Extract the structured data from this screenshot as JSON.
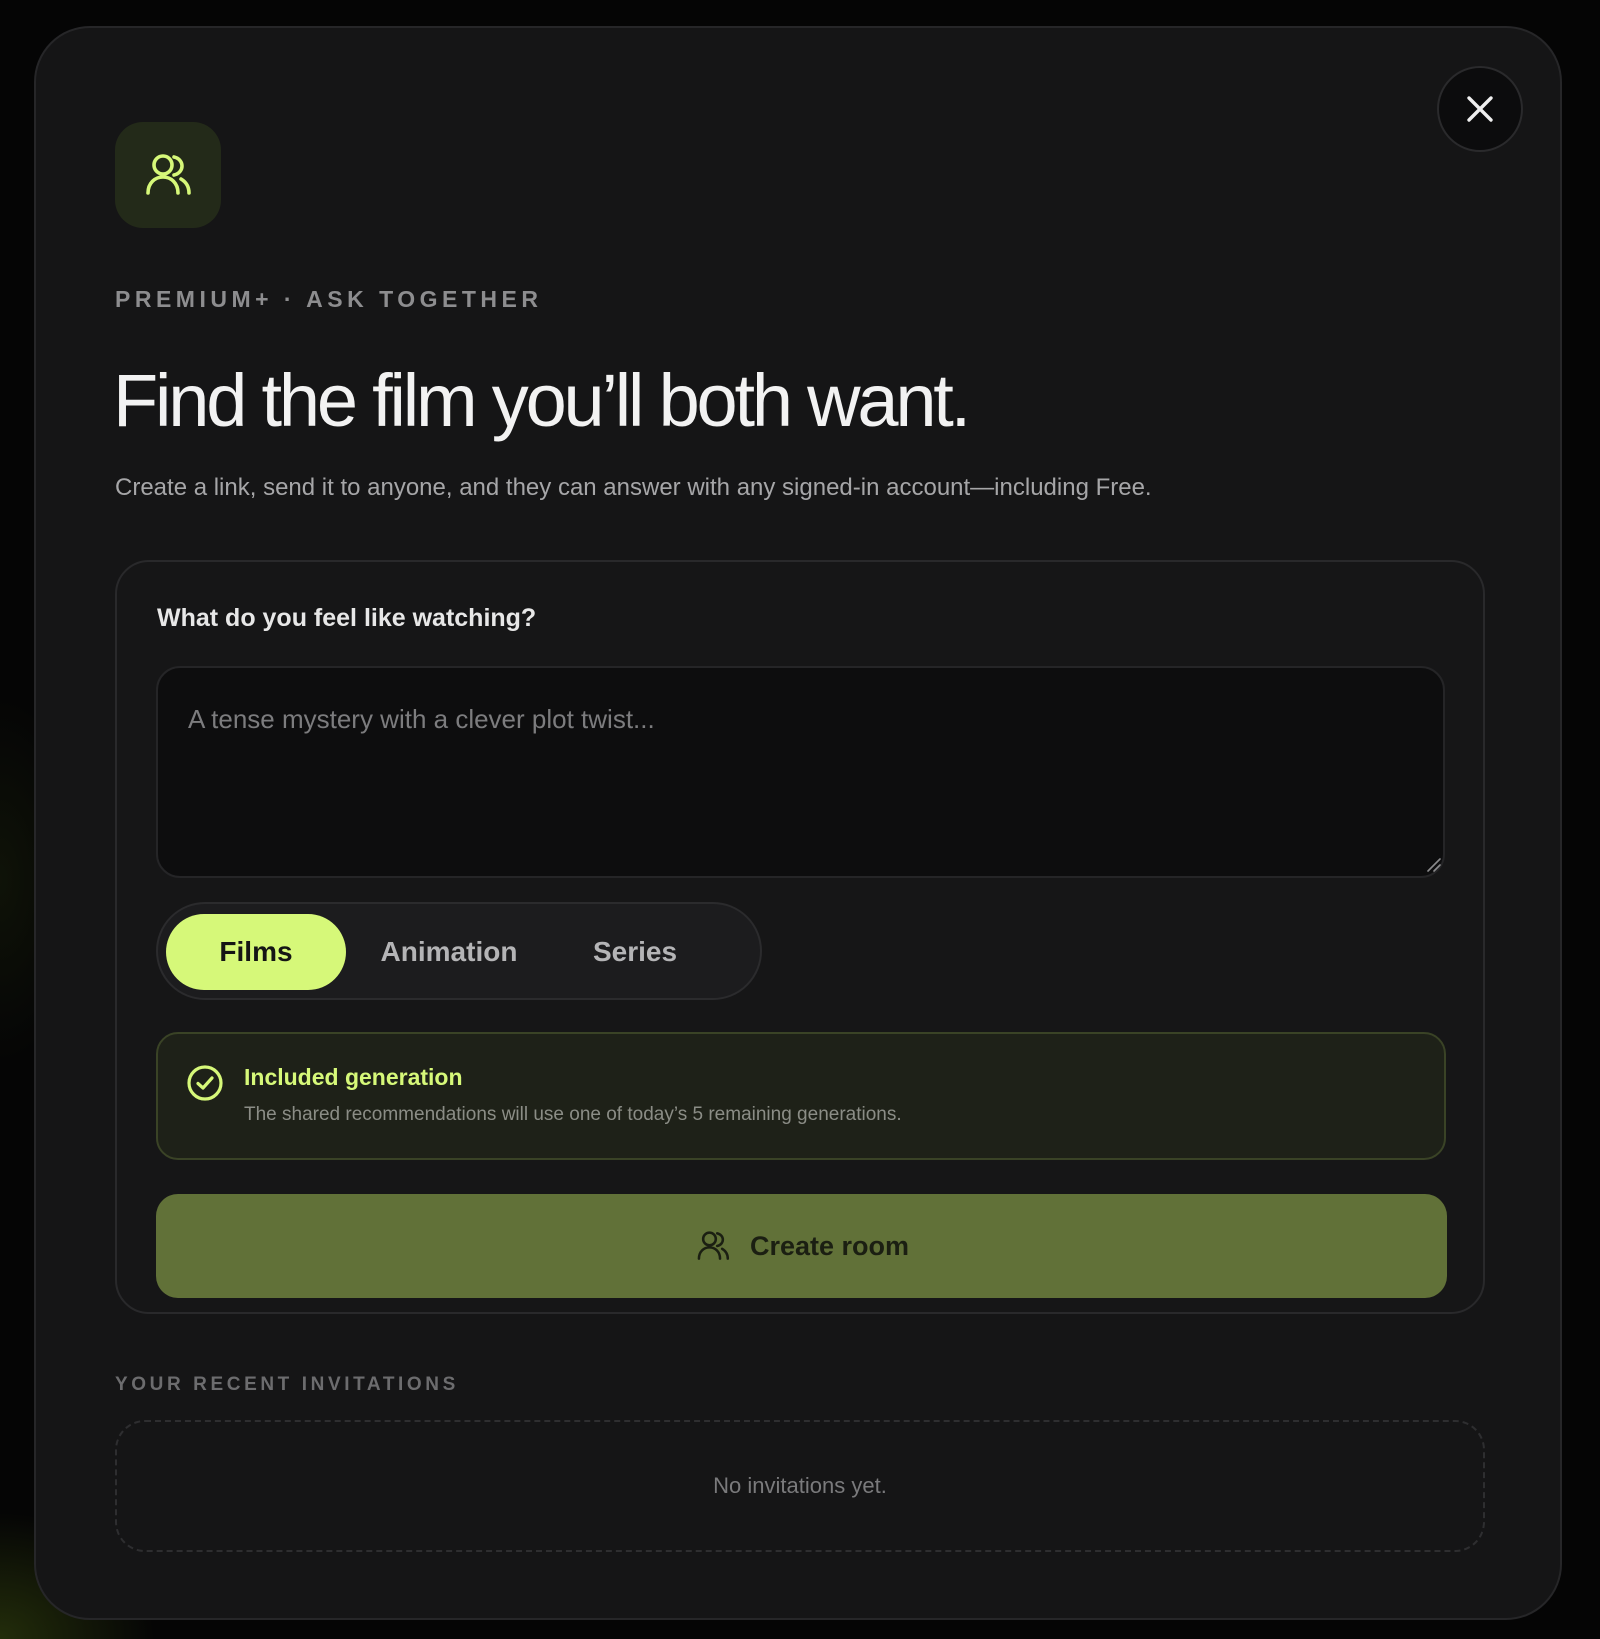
{
  "modal": {
    "eyebrow": "PREMIUM+ · ASK TOGETHER",
    "title": "Find the film you’ll both want.",
    "subtitle": "Create a link, send it to anyone, and they can answer with any signed-in account—including Free.",
    "close_icon": "close-icon",
    "badge_icon": "users-icon"
  },
  "form": {
    "question_label": "What do you feel like watching?",
    "prompt_value": "",
    "prompt_placeholder": "A tense mystery with a clever plot twist...",
    "content_types": [
      {
        "label": "Films",
        "selected": true
      },
      {
        "label": "Animation",
        "selected": false
      },
      {
        "label": "Series",
        "selected": false
      }
    ],
    "notice": {
      "icon": "check-circle-icon",
      "title": "Included generation",
      "text": "The shared recommendations will use one of today’s 5 remaining generations."
    },
    "create_button": {
      "icon": "users-icon",
      "label": "Create room"
    }
  },
  "recent": {
    "label": "YOUR RECENT INVITATIONS",
    "empty_text": "No invitations yet."
  },
  "colors": {
    "accent": "#d6f879",
    "button": "#617138",
    "background": "#151516"
  }
}
